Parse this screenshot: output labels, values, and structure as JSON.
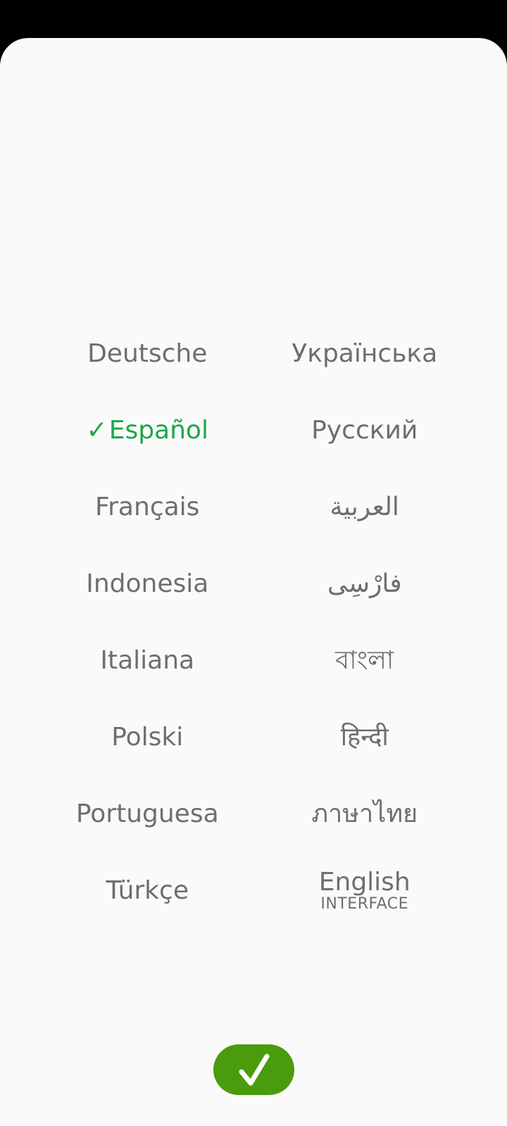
{
  "languages": {
    "left": [
      {
        "label": "Deutsche"
      },
      {
        "label": "Español",
        "selected": true
      },
      {
        "label": "Français"
      },
      {
        "label": "Indonesia"
      },
      {
        "label": "Italiana"
      },
      {
        "label": "Polski"
      },
      {
        "label": "Portuguesa"
      },
      {
        "label": "Türkçe"
      }
    ],
    "right": [
      {
        "label": "Українська"
      },
      {
        "label": "Русский"
      },
      {
        "label": "العربية"
      },
      {
        "label": "فارْسِی"
      },
      {
        "label": "বাংলা"
      },
      {
        "label": "हिन्दी"
      },
      {
        "label": "ภาษาไทย"
      },
      {
        "label": "English",
        "sublabel": "INTERFACE"
      }
    ],
    "selected_check": "✓"
  },
  "confirm_button": {
    "icon": "checkmark-icon"
  },
  "colors": {
    "background": "#fafafa",
    "text": "#6e6e6e",
    "selected": "#1fa64a",
    "confirm": "#4a9c0c"
  }
}
